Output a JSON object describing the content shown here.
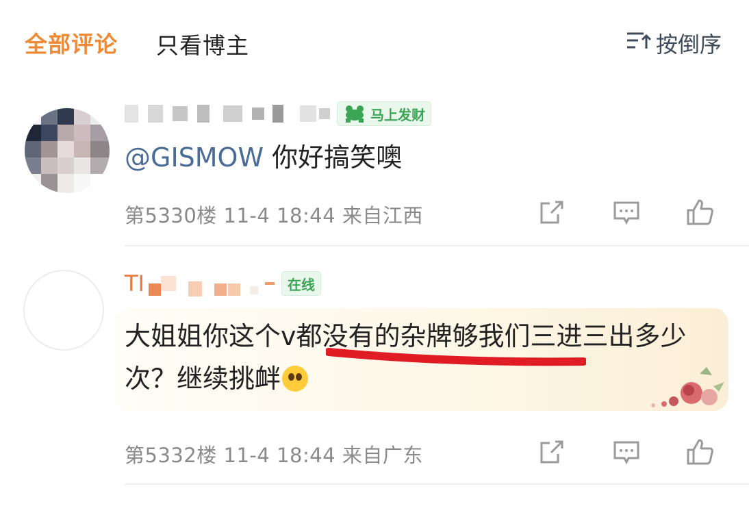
{
  "tabs": {
    "all_comments": "全部评论",
    "blogger_only": "只看博主",
    "sort_label": "按倒序"
  },
  "icons": {
    "sort": "sort-desc-icon",
    "repost": "repost-icon",
    "reply": "reply-icon",
    "like": "like-icon"
  },
  "comments": [
    {
      "badge": "马上发财",
      "mention": "@GISMOW",
      "text": " 你好搞笑噢",
      "floor": "第5330楼",
      "time": "11-4 18:44",
      "location": "来自江西"
    },
    {
      "name_prefix": "TI",
      "badge": "在线",
      "text": "大姐姐你这个v都没有的杂牌够我们三进三出多少次？继续挑衅",
      "floor": "第5332楼",
      "time": "11-4 18:44",
      "location": "来自广东"
    }
  ],
  "colors": {
    "accent": "#ee8a36",
    "mention": "#4a6b96",
    "meta": "#8a8a8a",
    "badge_green": "#3aa554",
    "annotation_red": "#e01c25"
  }
}
